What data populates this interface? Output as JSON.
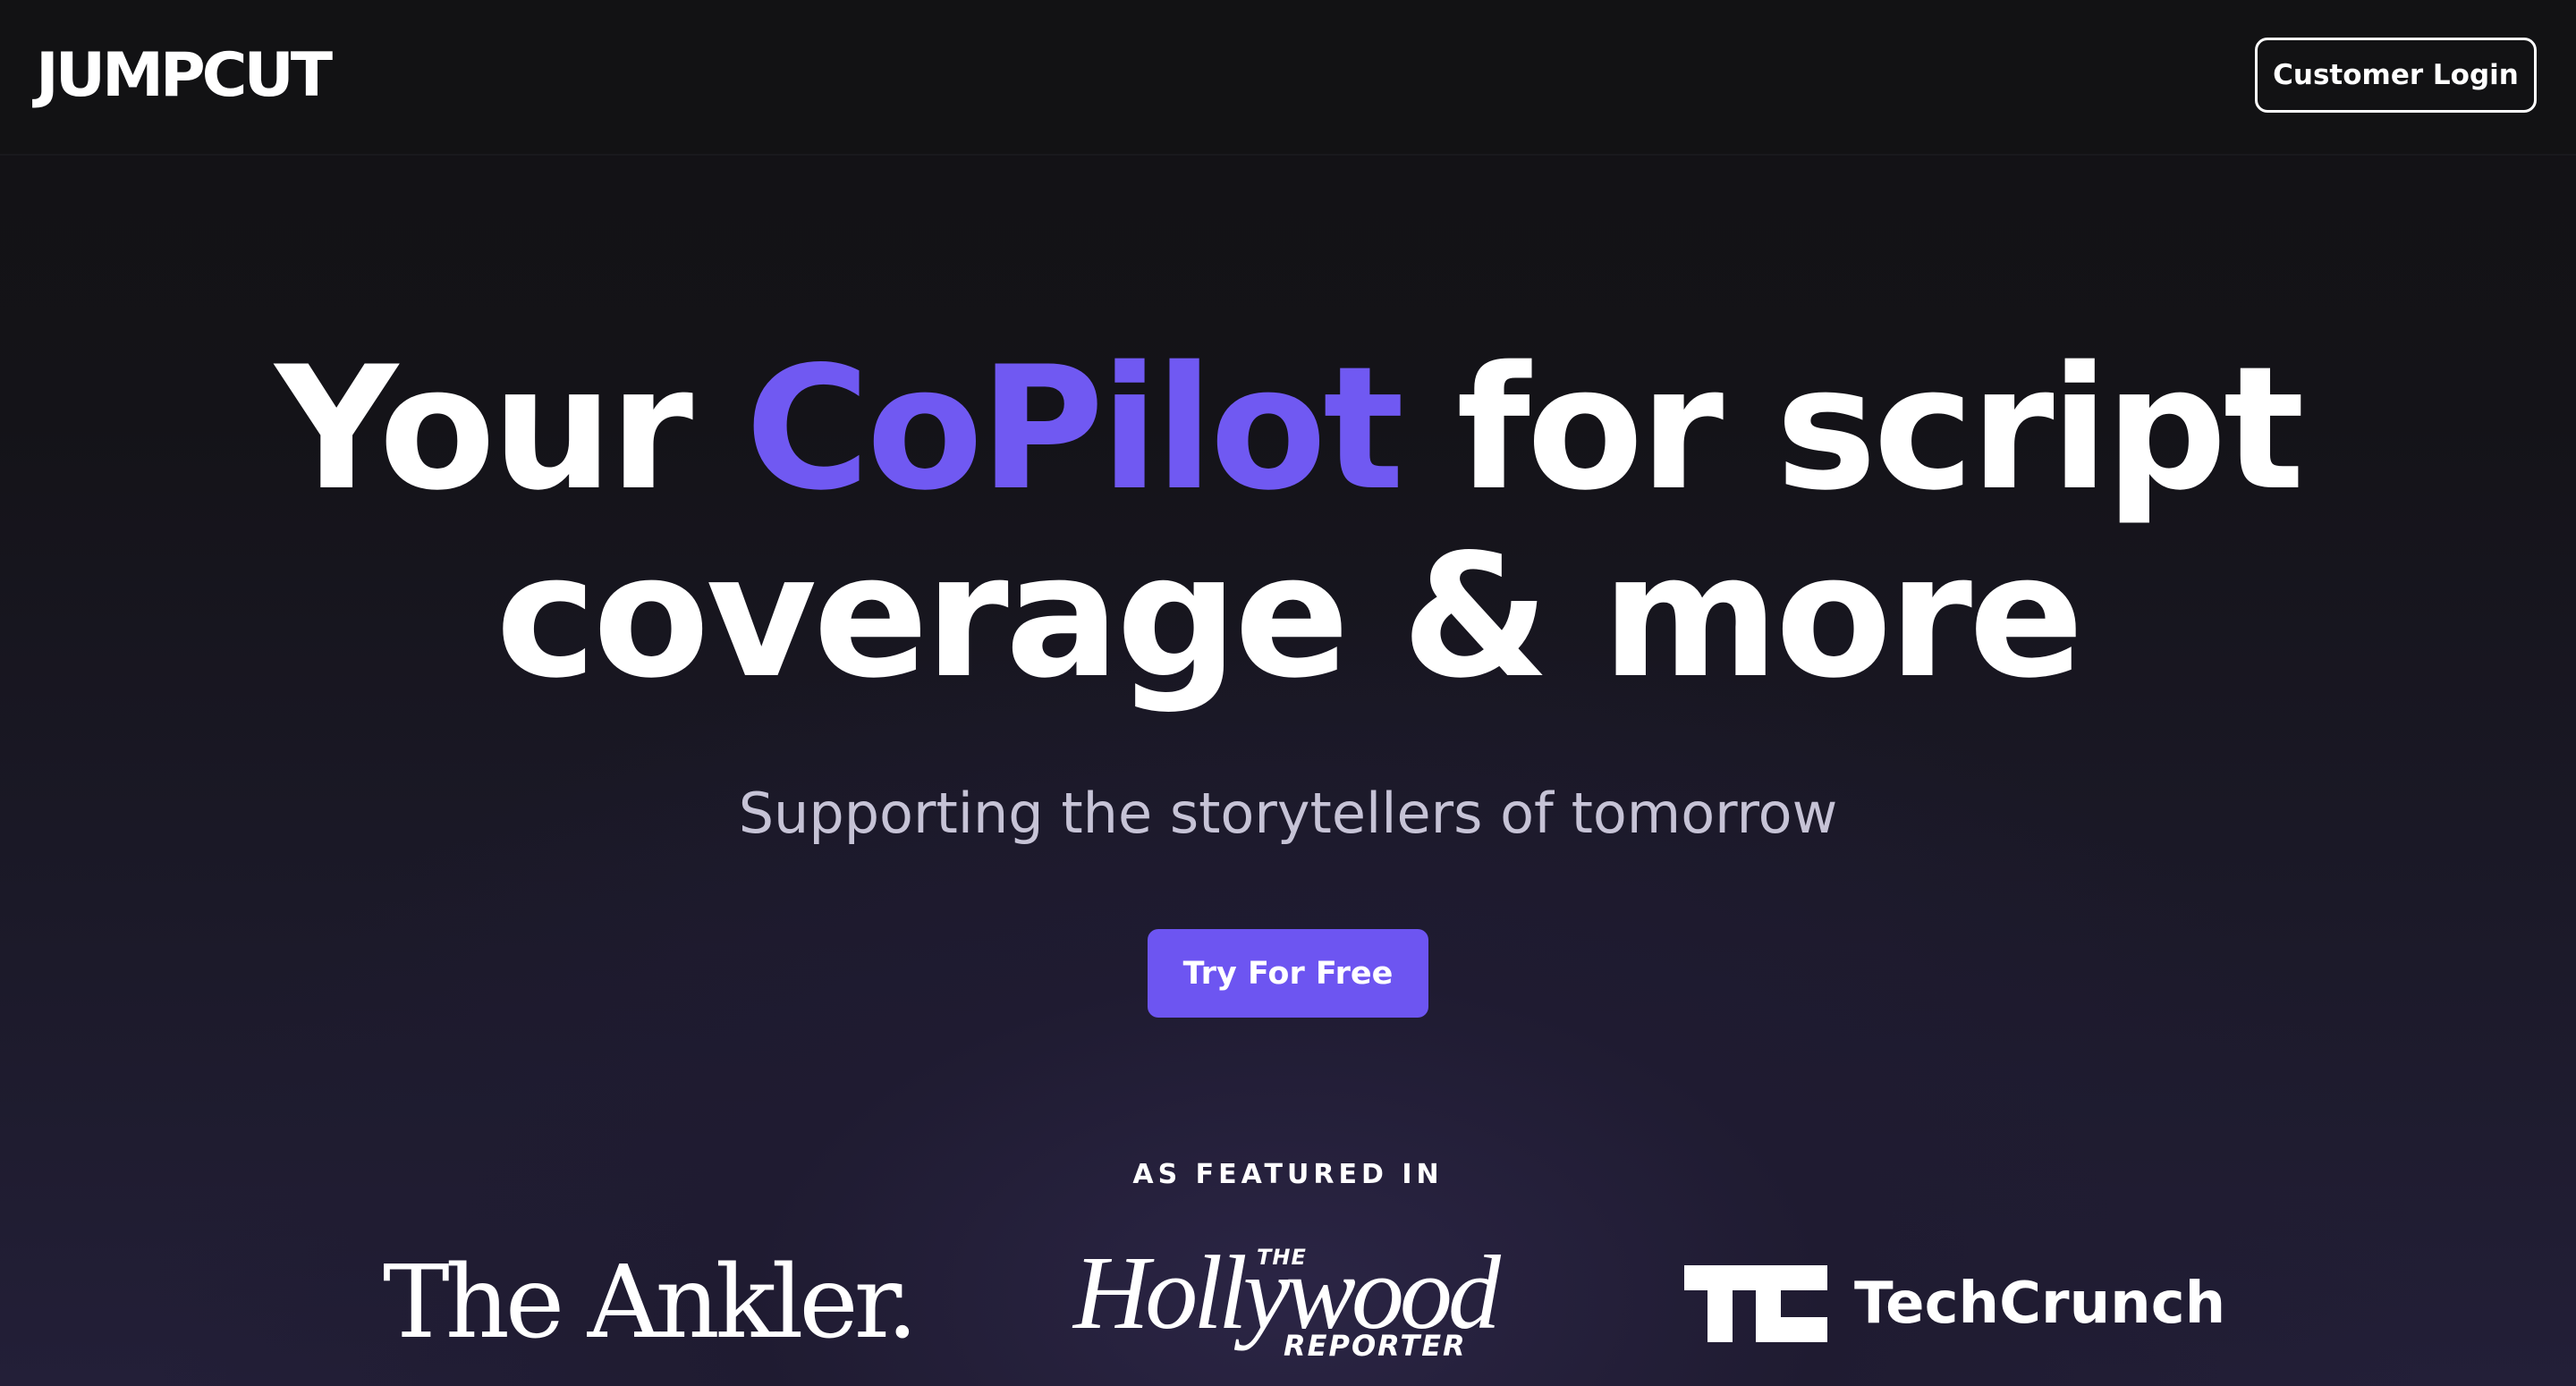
{
  "navbar": {
    "logo_text": "JUMPCUT",
    "login_label": "Customer Login"
  },
  "hero": {
    "title_part1": "Your ",
    "title_accent": "CoPilot",
    "title_part2": " for script",
    "title_line2": "coverage & more",
    "subtitle": "Supporting the storytellers of tomorrow",
    "cta_label": "Try For Free"
  },
  "featured": {
    "label": "AS FEATURED IN",
    "logos": {
      "ankler": "The Ankler.",
      "hollywood_reporter_the": "THE",
      "hollywood_reporter_main": "Hollywood",
      "hollywood_reporter_sub": "REPORTER",
      "techcrunch": "TechCrunch"
    }
  },
  "colors": {
    "accent": "#7059f2",
    "cta_background": "#6d55f1",
    "background": "#121214"
  }
}
